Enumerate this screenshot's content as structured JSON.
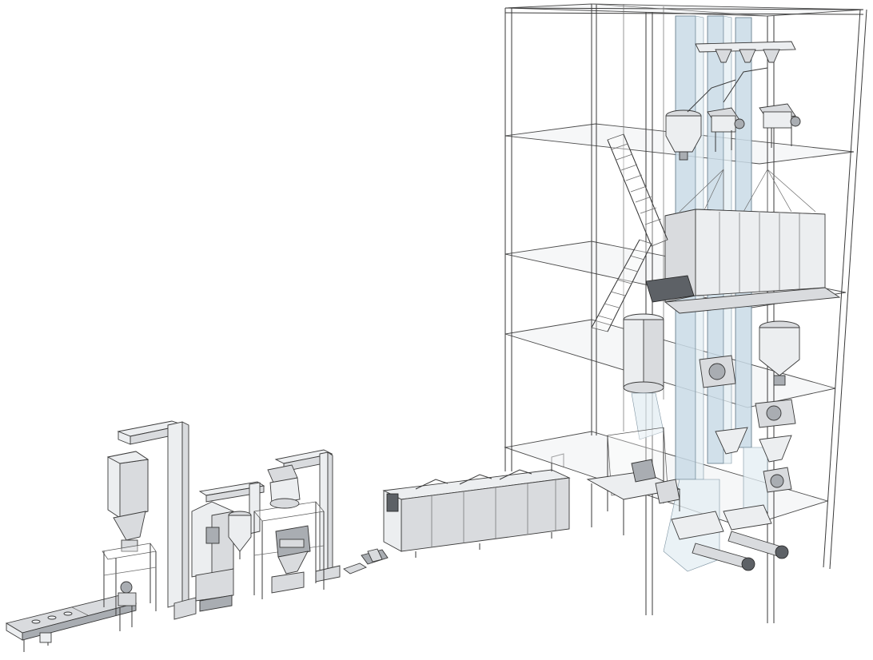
{
  "image": {
    "kind": "3D line illustration of an industrial processing plant",
    "text_labels": []
  },
  "structure": {
    "floors": 6
  },
  "colors": {
    "background": "#ffffff",
    "steel": "#d9dbde",
    "steel_dark": "#a9adb2",
    "duct": "#c9dbe6",
    "outline": "#3a3a3a"
  },
  "components": [
    "feed-conveyor",
    "storage-silo",
    "bucket-elevator",
    "cyclone-dryer-unit",
    "mill-unit",
    "belt-oven",
    "tower-frame",
    "bin-block",
    "staircase",
    "vertical-ducts"
  ]
}
